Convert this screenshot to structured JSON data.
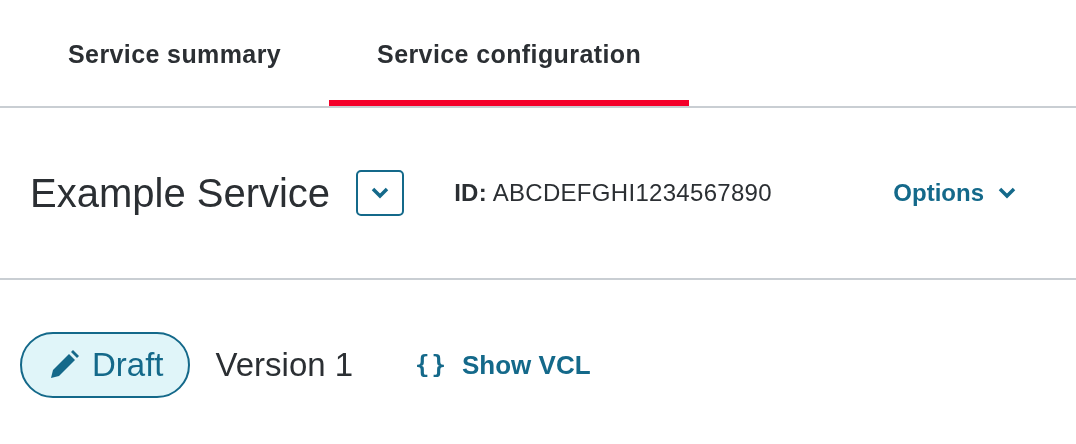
{
  "tabs": [
    {
      "label": "Service summary",
      "selected": false
    },
    {
      "label": "Service configuration",
      "selected": true
    }
  ],
  "service": {
    "name": "Example Service",
    "id": "**ID:** ABCDEFGHI1234567890",
    "options": "Options"
  },
  "version": {
    "status": "Draft",
    "label": "Version 1",
    "vcl_icon": "{}",
    "vcl_link": "Show VCL"
  }
}
